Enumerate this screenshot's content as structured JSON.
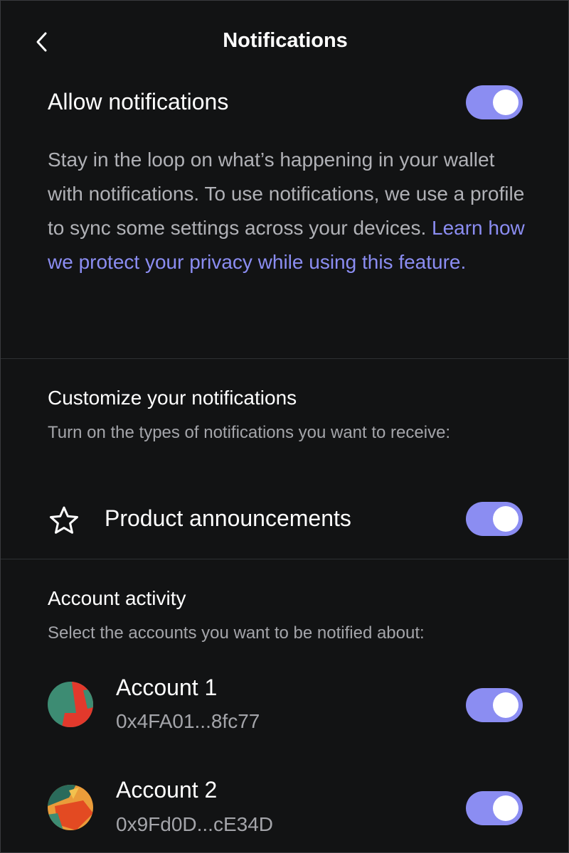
{
  "header": {
    "title": "Notifications",
    "back_icon": "chevron-left-icon"
  },
  "allow": {
    "title": "Allow notifications",
    "enabled": true,
    "description": "Stay in the loop on what’s happening in your wallet with notifications. To use notifications, we use a profile to sync some settings across your devices. ",
    "link_text": "Learn how we protect your privacy while using this feature."
  },
  "customize": {
    "title": "Customize your notifications",
    "subtitle": "Turn on the types of notifications you want to receive:",
    "product": {
      "icon": "star-icon",
      "label": "Product announcements",
      "enabled": true
    }
  },
  "activity": {
    "title": "Account activity",
    "subtitle": "Select the accounts you want to be notified about:",
    "accounts": [
      {
        "name": "Account 1",
        "address": "0x4FA01...8fc77",
        "enabled": true
      },
      {
        "name": "Account 2",
        "address": "0x9Fd0D...cE34D",
        "enabled": true
      }
    ]
  },
  "colors": {
    "background": "#121314",
    "accent": "#8b8df2",
    "muted_text": "#b0b1b6",
    "divider": "#2e3033"
  }
}
